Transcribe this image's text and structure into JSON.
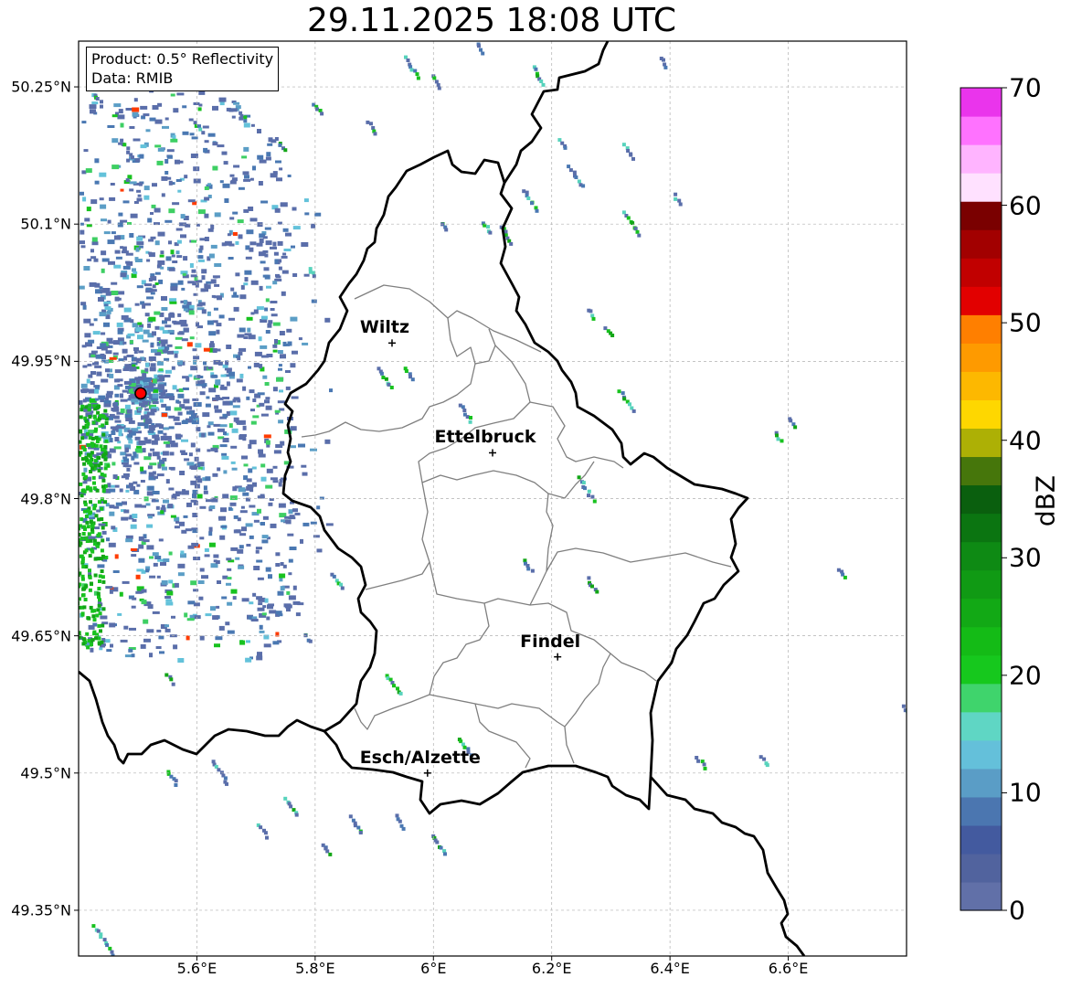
{
  "title": "29.11.2025 18:08 UTC",
  "info": {
    "product": "Product: 0.5° Reflectivity",
    "data": "Data: RMIB"
  },
  "lat_ticks": [
    {
      "value": 50.25,
      "label": "50.25°N"
    },
    {
      "value": 50.1,
      "label": "50.1°N"
    },
    {
      "value": 49.95,
      "label": "49.95°N"
    },
    {
      "value": 49.8,
      "label": "49.8°N"
    },
    {
      "value": 49.65,
      "label": "49.65°N"
    },
    {
      "value": 49.5,
      "label": "49.5°N"
    },
    {
      "value": 49.35,
      "label": "49.35°N"
    }
  ],
  "lon_ticks": [
    {
      "value": 5.6,
      "label": "5.6°E"
    },
    {
      "value": 5.8,
      "label": "5.8°E"
    },
    {
      "value": 6.0,
      "label": "6°E"
    },
    {
      "value": 6.2,
      "label": "6.2°E"
    },
    {
      "value": 6.4,
      "label": "6.4°E"
    },
    {
      "value": 6.6,
      "label": "6.6°E"
    }
  ],
  "extent": {
    "lon_min": 5.4,
    "lon_max": 6.8,
    "lat_min": 49.3,
    "lat_max": 50.3
  },
  "cities": [
    {
      "name": "Wiltz",
      "lon": 5.93,
      "lat": 49.97
    },
    {
      "name": "Ettelbruck",
      "lon": 6.1,
      "lat": 49.85
    },
    {
      "name": "Findel",
      "lon": 6.21,
      "lat": 49.627
    },
    {
      "name": "Esch/Alzette",
      "lon": 5.99,
      "lat": 49.5
    }
  ],
  "radar": {
    "lon": 5.505,
    "lat": 49.915,
    "color": "#ff0000"
  },
  "colorbar": {
    "label": "dBZ",
    "min": 0,
    "max": 70,
    "ticks": [
      "0",
      "10",
      "20",
      "30",
      "40",
      "50",
      "60",
      "70"
    ],
    "colors": [
      "#6170a8",
      "#51639e",
      "#435a9f",
      "#4b76b0",
      "#5a9dc6",
      "#64c0da",
      "#5fd6c4",
      "#3fd46c",
      "#16c81d",
      "#14bb16",
      "#12a915",
      "#109a14",
      "#0e8a14",
      "#0b7511",
      "#0a5f0e",
      "#46760b",
      "#adb005",
      "#fed700",
      "#fdb800",
      "#fe9a00",
      "#ff7f00",
      "#e20000",
      "#c10000",
      "#a20000",
      "#7a0000",
      "#ffe1ff",
      "#ffb4ff",
      "#ff72ff",
      "#ea34ec"
    ]
  },
  "reflectivity_palette": [
    "#5a6eaa",
    "#4a78b2",
    "#5b9ec6",
    "#63c2da",
    "#57d3bc",
    "#3ecf63",
    "#18c21f",
    "#12a616",
    "#0d8b13",
    "#ff3b00",
    "#f6a000"
  ]
}
